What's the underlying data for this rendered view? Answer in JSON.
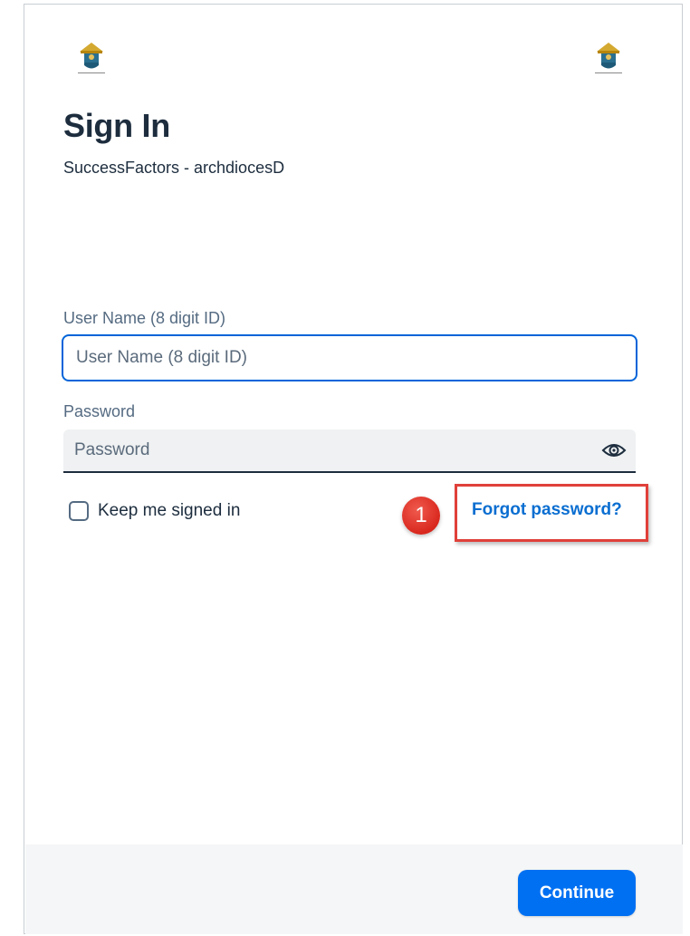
{
  "logos": {
    "left_icon": "crest-logo-icon",
    "right_icon": "crest-logo-icon"
  },
  "header": {
    "title": "Sign In",
    "subtitle": "SuccessFactors - archdiocesD"
  },
  "form": {
    "username_label": "User Name (8 digit ID)",
    "username_placeholder": "User Name (8 digit ID)",
    "username_value": "",
    "password_label": "Password",
    "password_placeholder": "Password",
    "password_value": "",
    "show_password_icon": "eye-icon",
    "keep_signed_in_label": "Keep me signed in",
    "keep_signed_in_checked": false,
    "forgot_password_label": "Forgot password?"
  },
  "annotation": {
    "step_number": "1",
    "highlight_color": "#e0403a",
    "badge_color": "#d9281e"
  },
  "footer": {
    "continue_label": "Continue"
  },
  "colors": {
    "accent": "#0070f2",
    "link": "#0a6ed1",
    "focus_border": "#0064d9",
    "text": "#1d2d3e"
  }
}
